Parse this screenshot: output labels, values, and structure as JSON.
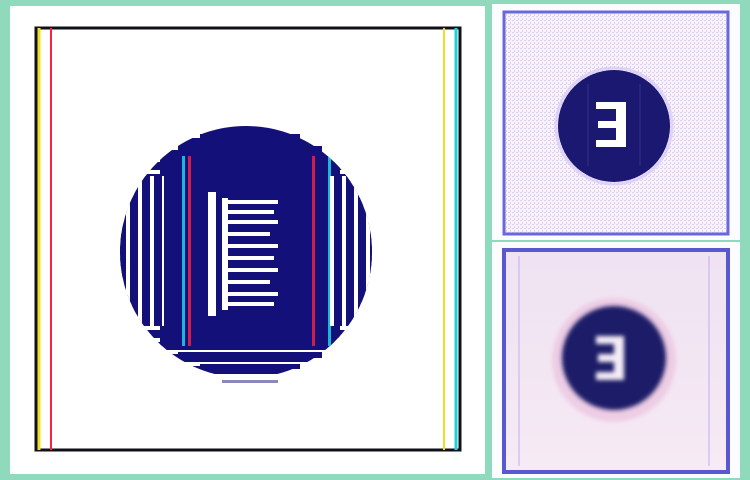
{
  "figure": {
    "background_color": "#8fd9bd",
    "panels": [
      {
        "id": "main",
        "description_colors": {
          "frame": "#101018",
          "accent_left": "#f0e020",
          "accent_right": "#20d0d8",
          "glyph": "#14107a",
          "fringe_red": "#ff2040",
          "fringe_cyan": "#20e0f0"
        },
        "glyph_icon": "halftone-circle-letter-e-icon"
      },
      {
        "id": "top-right",
        "description_colors": {
          "frame": "#6a68d8",
          "glyph": "#1a1870",
          "fill": "#f4f0ff"
        },
        "glyph_icon": "noisy-circle-letter-e-icon"
      },
      {
        "id": "bottom-right",
        "description_colors": {
          "frame": "#5a58d0",
          "glyph": "#1a1a68",
          "fill": "#f3e6f2",
          "halo": "#e8b8d8"
        },
        "glyph_icon": "blurred-circle-letter-e-icon"
      }
    ]
  }
}
